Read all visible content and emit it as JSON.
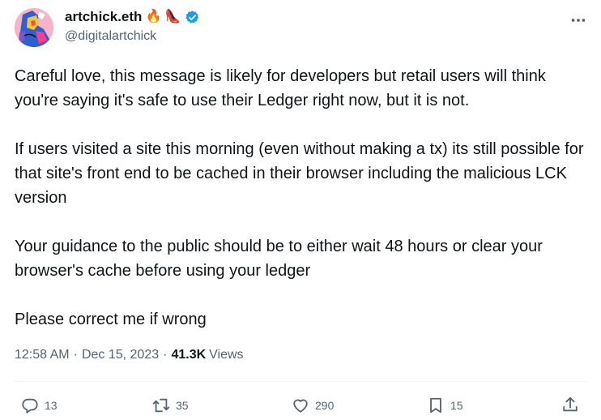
{
  "author": {
    "display_name": "artchick.eth",
    "emojis": [
      "🔥",
      "👠"
    ],
    "handle": "@digitalartchick",
    "verified_color": "#1d9bf0"
  },
  "tweet": {
    "paragraphs": [
      "Careful love, this message is likely for developers but retail users will think you're saying it's safe to use their Ledger right now, but it is not.",
      "If users visited a site this morning (even without making a tx) its still possible for that site's front end to be cached in their browser including the malicious LCK version",
      "Your guidance to the public should be to either wait 48 hours or clear your browser's cache before using your ledger",
      "Please correct me if wrong"
    ]
  },
  "meta": {
    "time": "12:58 AM",
    "separator": "·",
    "date": "Dec 15, 2023",
    "views_count": "41.3K",
    "views_label": "Views"
  },
  "actions": {
    "reply_count": "13",
    "retweet_count": "35",
    "like_count": "290",
    "bookmark_count": "15"
  },
  "icons": {
    "more": "more-horizontal-icon",
    "reply": "reply-icon",
    "retweet": "retweet-icon",
    "like": "heart-icon",
    "bookmark": "bookmark-icon",
    "share": "share-icon",
    "verified": "verified-badge-icon"
  }
}
